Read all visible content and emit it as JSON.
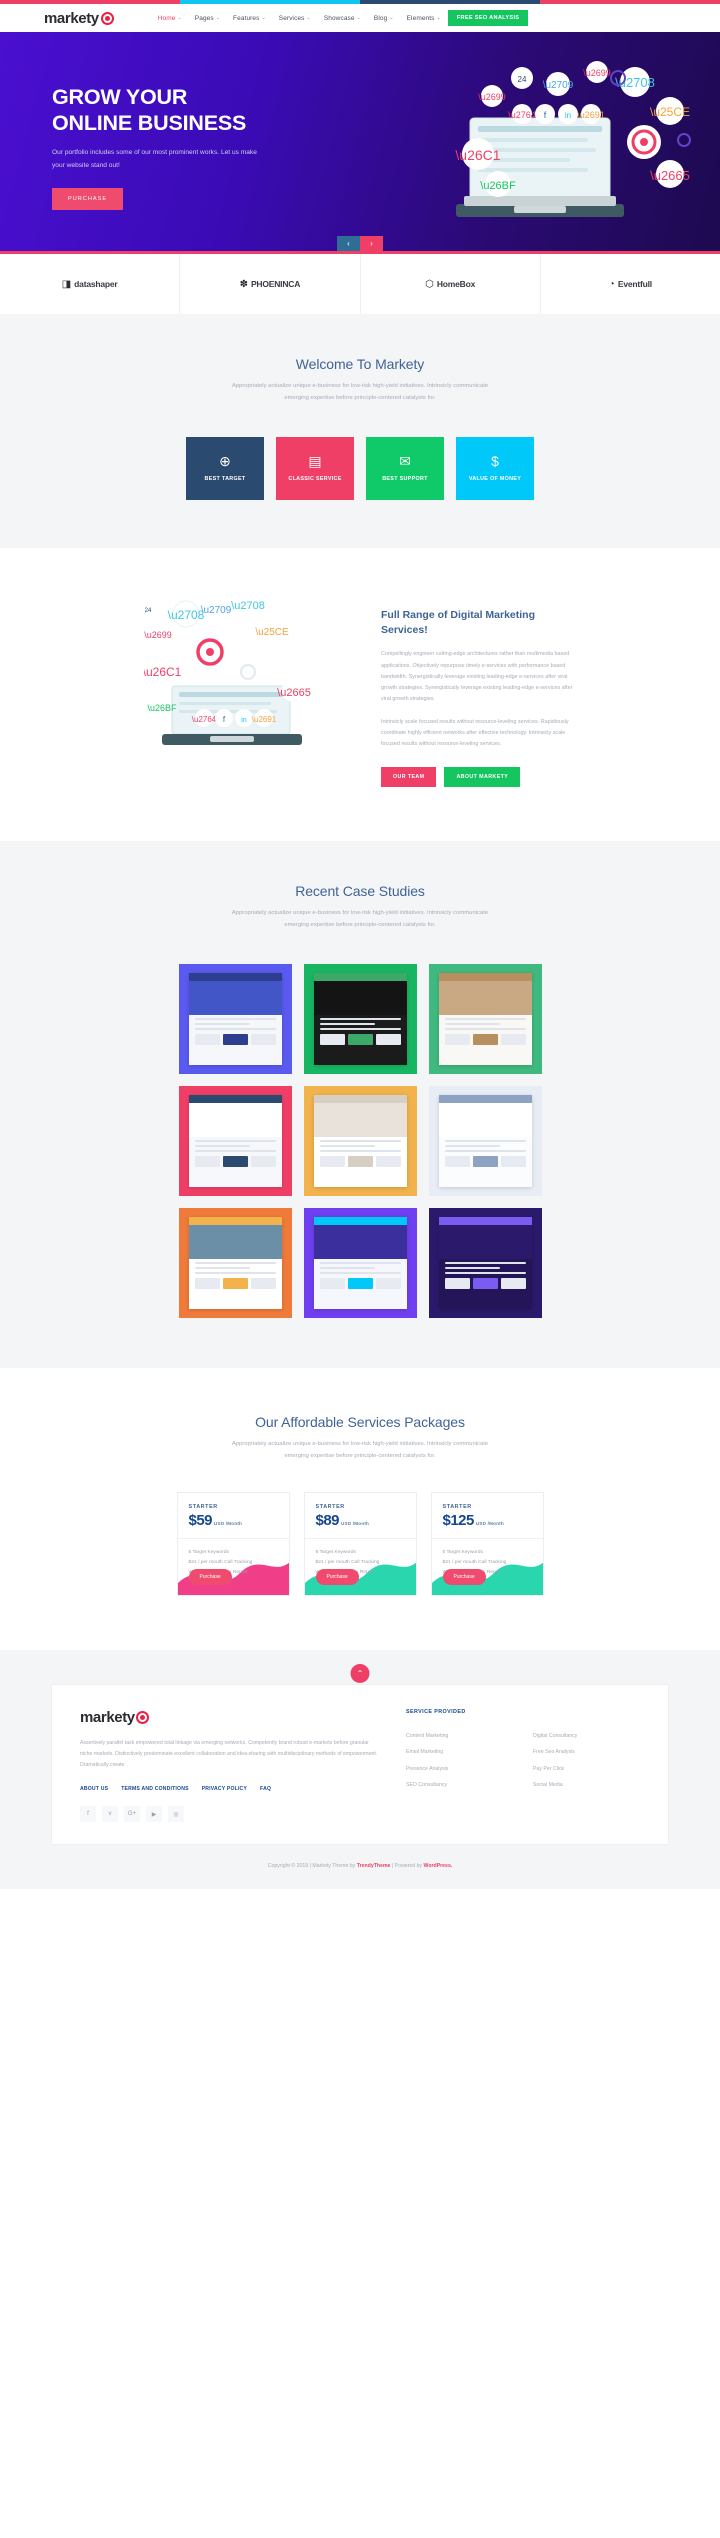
{
  "accent_colors": [
    "#ef3f67",
    "#0fc6f3",
    "#2b4a6f",
    "#ef3f67"
  ],
  "header": {
    "logo_text": "markety",
    "nav": [
      {
        "label": "Home",
        "caret": "⌄",
        "active": true
      },
      {
        "label": "Pages",
        "caret": "⌄",
        "active": false
      },
      {
        "label": "Features",
        "caret": "⌄",
        "active": false
      },
      {
        "label": "Services",
        "caret": "⌄",
        "active": false
      },
      {
        "label": "Showcase",
        "caret": "⌄",
        "active": false
      },
      {
        "label": "Blog",
        "caret": "⌄",
        "active": false
      },
      {
        "label": "Elements",
        "caret": "⌄",
        "active": false
      }
    ],
    "cta_label": "FREE SEO ANALYSIS",
    "cta_color": "#15c55f"
  },
  "hero": {
    "title_line1": "GROW YOUR",
    "title_line2": "ONLINE BUSINESS",
    "subtitle": "Our portfolio includes some of our most prominent works. Let us make your website stand out!",
    "button_label": "PURCHASE",
    "prev_icon": "‹",
    "next_icon": "›"
  },
  "clients": [
    {
      "name": "datashaper",
      "mark": "◨"
    },
    {
      "name": "PHOENINCA",
      "mark": "✽"
    },
    {
      "name": "HomeBox",
      "mark": "⬡"
    },
    {
      "name": "Eventfull",
      "mark": "◔"
    }
  ],
  "welcome": {
    "title": "Welcome To Markety",
    "subtitle_line1": "Appropriately actualize unique e-business for low-risk high-yield initiatives. Intrinsicly communicate",
    "subtitle_line2": "emerging expertise before principle-centered catalysts for.",
    "boxes": [
      {
        "label": "BEST TARGET",
        "icon": "⊕",
        "color": "#2b4a6f"
      },
      {
        "label": "CLASSIC SERVICE",
        "icon": "▤",
        "color": "#ef3f67"
      },
      {
        "label": "BEST SUPPORT",
        "icon": "✉",
        "color": "#10c969"
      },
      {
        "label": "VALUE OF MONEY",
        "icon": "$",
        "color": "#00c8f8"
      }
    ]
  },
  "fullrange": {
    "title": "Full Range of Digital Marketing Services!",
    "body_line1": "Compellingly engineer cutting-edge architectures rather than multimedia",
    "body_line2": "based applications. Objectively repurpose timely e-services with performance",
    "body_line3": "based bandwidth. Synergistically leverage existing leading-edge e-services",
    "body_line4": "after viral growth strategies. Synergistically leverage existing leading-edge",
    "body_line5": "e-services after viral growth strategies.",
    "body_line6": "Intrinsicly scale focused results without resource-leveling services.",
    "body_line7": "Rapidiously coordinate highly efficient networks after effective technology.",
    "body_line8": "Intrinsicly scale focused results without resource-leveling services.",
    "btn_team": "OUR TEAM",
    "btn_about": "ABOUT MARKETY"
  },
  "cases": {
    "title": "Recent Case Studies",
    "subtitle_line1": "Appropriately actualize unique e-business for low-risk high-yield initiatives. Intrinsicly communicate",
    "subtitle_line2": "emerging expertise before principle-centered catalysts for.",
    "items": [
      {
        "bg": "#5a5af0",
        "shot_top": "#4356c8",
        "shot_body": "#f5f7fb",
        "accent": "#2d3e8f"
      },
      {
        "bg": "#18b663",
        "shot_top": "#141414",
        "shot_body": "#1b1b1b",
        "accent": "#3ea86b"
      },
      {
        "bg": "#3fb97f",
        "shot_top": "#c9a884",
        "shot_body": "#faf8f4",
        "accent": "#b8905f"
      },
      {
        "bg": "#ef3f67",
        "shot_top": "#ffffff",
        "shot_body": "#f7f8fc",
        "accent": "#2b4a6f"
      },
      {
        "bg": "#f2b24c",
        "shot_top": "#e8e2da",
        "shot_body": "#ffffff",
        "accent": "#d8cfc4"
      },
      {
        "bg": "#e8edf5",
        "shot_top": "#ffffff",
        "shot_body": "#fbfcfe",
        "accent": "#8ea2c4"
      },
      {
        "bg": "#ef7a3a",
        "shot_top": "#6c8fa8",
        "shot_body": "#ffffff",
        "accent": "#f2b24c"
      },
      {
        "bg": "#6f3ff0",
        "shot_top": "#3b2f9e",
        "shot_body": "#f6f7fd",
        "accent": "#00c8f8"
      },
      {
        "bg": "#2b1a6b",
        "shot_top": "#2b1a6b",
        "shot_body": "#241559",
        "accent": "#7b5cf0"
      }
    ]
  },
  "pricing": {
    "title": "Our Affordable Services Packages",
    "subtitle_line1": "Appropriately actualize unique e-business for low-risk high-yield initiatives. Intrinsicly communicate",
    "subtitle_line2": "emerging expertise before principle-centered catalysts for.",
    "plans": [
      {
        "name": "STARTER",
        "price": "$59",
        "period": "USD /Month",
        "features": [
          "5 Target Keywords",
          "$21 / per mouth Call Tracking",
          "Weekly SEO Status Report"
        ],
        "button": "Purchase",
        "wave": "#ef2f7e"
      },
      {
        "name": "STARTER",
        "price": "$89",
        "period": "USD /Month",
        "features": [
          "5 Target Keywords",
          "$21 / per mouth Call Tracking",
          "Weekly SEO Status Report"
        ],
        "button": "Purchase",
        "wave": "#17d3a7"
      },
      {
        "name": "STARTER",
        "price": "$125",
        "period": "USD /Month",
        "features": [
          "5 Target Keywords",
          "$21 / per mouth Call Tracking",
          "Weekly SEO Status Report"
        ],
        "button": "Purchase",
        "wave": "#17d3a7"
      }
    ]
  },
  "footer": {
    "to_top_icon": "⌃",
    "logo_text": "markety",
    "description": "Assertively parallel task empowered total linkage via emerging networks. Competently brand robust e-markets before granular niche markets. Distinctively predominate excellent collaboration and idea-sharing with multidisciplinary methods of empowerment. Dramatically create.",
    "links": [
      "ABOUT US",
      "TERMS AND CONDITIONS",
      "PRIVACY POLICY",
      "FAQ"
    ],
    "socials": [
      "f",
      "ᴠ",
      "G+",
      "▶",
      "◎"
    ],
    "services_heading": "SERVICE PROVIDED",
    "services_col1": [
      "Content Marketing",
      "Email Marketing",
      "Presence Analysis",
      "SEO Consultancy"
    ],
    "services_col2": [
      "Digital Consultancy",
      "Free Seo Analysis",
      "Pay Per Click",
      "Social Media"
    ],
    "copyright_pre": "Copyright © 2019 | Markety Theme by ",
    "copyright_brand1": "TrendyTheme",
    "copyright_mid": " | Powered by ",
    "copyright_brand2": "WordPress."
  }
}
